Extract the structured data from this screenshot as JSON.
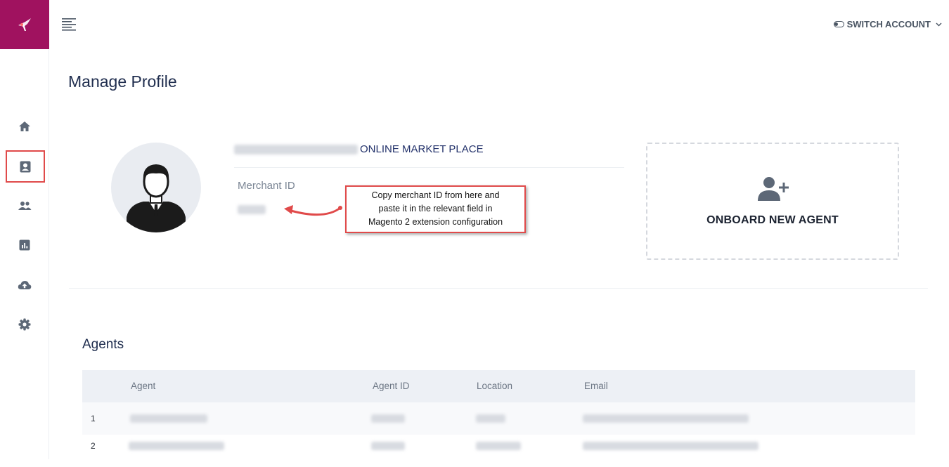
{
  "header": {
    "switch_label": "SWITCH ACCOUNT"
  },
  "sidebar": {
    "items": [
      {
        "icon": "home-icon"
      },
      {
        "icon": "profile-icon",
        "active": true
      },
      {
        "icon": "users-icon"
      },
      {
        "icon": "report-icon"
      },
      {
        "icon": "cloud-upload-icon"
      },
      {
        "icon": "gear-icon"
      }
    ]
  },
  "page": {
    "title": "Manage Profile"
  },
  "profile": {
    "company_suffix": "ONLINE MARKET PLACE",
    "merchant_label": "Merchant ID"
  },
  "callout": {
    "line1": "Copy merchant ID from here and",
    "line2": "paste it in the relevant field in",
    "line3": "Magento 2 extension configuration"
  },
  "onboard": {
    "label": "ONBOARD NEW AGENT"
  },
  "agents": {
    "title": "Agents",
    "columns": [
      "Agent",
      "Agent ID",
      "Location",
      "Email"
    ],
    "rows": [
      {
        "index": "1"
      },
      {
        "index": "2"
      }
    ]
  },
  "colors": {
    "brand": "#a0125f",
    "highlight": "#e04a4a",
    "title": "#1f2d4e"
  }
}
